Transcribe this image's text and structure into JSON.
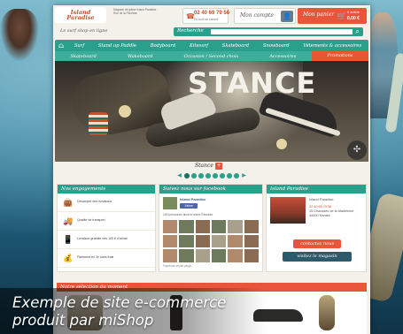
{
  "header": {
    "logo_text": "Island Paradise",
    "info_line1": "Magasin de glisse Island Paradise",
    "info_line2": "Rue de la Paroisse",
    "phone": "02 40 69 79 56",
    "phone_sub": "Du lundi au samedi",
    "account_label": "Mon compte",
    "cart_label": "Mon panier",
    "cart_count": "0 article",
    "cart_total": "0,00 €"
  },
  "search": {
    "tagline": "Le surf shop en ligne",
    "label": "Recherche",
    "placeholder": ""
  },
  "nav_primary": [
    "Surf",
    "Stand up Paddle",
    "Bodyboard",
    "Kitesurf",
    "Skateboard",
    "Snowboard",
    "Vêtements & accessoires"
  ],
  "nav_secondary": [
    {
      "label": "Skateboard",
      "active": false
    },
    {
      "label": "Wakeboard",
      "active": false
    },
    {
      "label": "Occasion / Second choix",
      "active": false
    },
    {
      "label": "Accessoires",
      "active": false
    },
    {
      "label": "Promotions",
      "active": true
    }
  ],
  "hero": {
    "wordmark": "STANCE",
    "caption": "Stance",
    "dots": 8,
    "active_dot": 1
  },
  "pledges": {
    "title": "Nos engagements",
    "items": [
      {
        "icon": "bag-icon",
        "text": "Décompte des livraisons"
      },
      {
        "icon": "truck-icon",
        "text": "Qualité de transport"
      },
      {
        "icon": "phone-icon",
        "text": "Livraison gratuite dès 100 € d'achat"
      },
      {
        "icon": "coins-icon",
        "text": "Paiement en 3x sans frais"
      }
    ]
  },
  "facebook": {
    "title": "Suivez nous sur facebook",
    "page_name": "Island Paradise",
    "like_label": "J'aime",
    "fans_text": "163 personnes aiment Island Paradise",
    "plugin_text": "Facebook social plugin",
    "faces": 18
  },
  "store": {
    "title": "Island Paradise",
    "name": "Island Paradise",
    "phone": "02 40 65 79 56",
    "address_line1": "15 Chaussée de la Madeleine",
    "address_line2": "44000 Nantes",
    "contact_label": "contactez nous",
    "visit_label": "visitez le magasin"
  },
  "selection": {
    "title": "Notre sélection du moment"
  },
  "overlay": {
    "line1": "Exemple de site e-commerce",
    "line2": "produit par miShop"
  },
  "colors": {
    "teal": "#2aa08c",
    "coral": "#e8553a",
    "navy": "#2e5b6b"
  }
}
